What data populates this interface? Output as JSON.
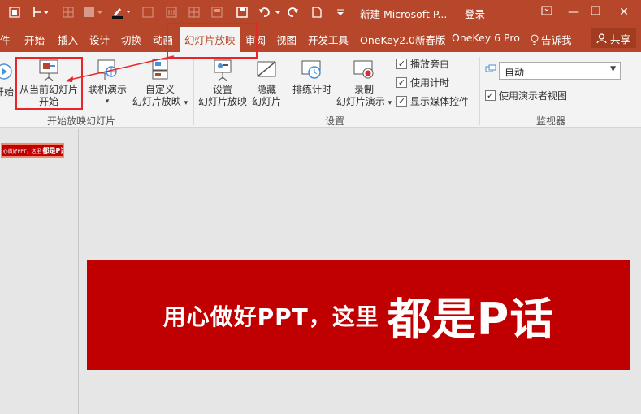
{
  "titlebar": {
    "doc_title": "新建 Microsoft P...",
    "login": "登录",
    "quick_access_icons": [
      "touch-mode-icon",
      "arrow-icon",
      "table-icon",
      "shape-icon",
      "pen-color-icon",
      "grid-icon",
      "bars-icon",
      "save-icon",
      "undo-icon",
      "redo-icon",
      "new-file-icon",
      "customize-icon"
    ]
  },
  "tabs": [
    "件",
    "开始",
    "插入",
    "设计",
    "切换",
    "动画",
    "幻灯片放映",
    "审阅",
    "视图",
    "开发工具",
    "OneKey2.0新春版",
    "OneKey 6 Pro",
    "告诉我"
  ],
  "share": "共享",
  "ribbon": {
    "start_group": {
      "from_start_partial": "开始",
      "from_current_line1": "从当前幻灯片",
      "from_current_line2": "开始",
      "online_present": "联机演示",
      "custom_line1": "自定义",
      "custom_line2": "幻灯片放映",
      "label": "开始放映幻灯片"
    },
    "setup_group": {
      "setup_line1": "设置",
      "setup_line2": "幻灯片放映",
      "hide_line1": "隐藏",
      "hide_line2": "幻灯片",
      "rehearse": "排练计时",
      "record_line1": "录制",
      "record_line2": "幻灯片演示",
      "play_narration": "播放旁白",
      "use_timings": "使用计时",
      "show_media_controls": "显示媒体控件",
      "label": "设置"
    },
    "monitor_group": {
      "monitor_value": "自动",
      "presenter_view": "使用演示者视图",
      "label": "监视器"
    }
  },
  "thumbnail": {
    "text_small": "用心做好PPT，这里",
    "text_big": "都是P话"
  },
  "slide": {
    "text_small": "用心做好PPT，这里",
    "text_big": "都是P话"
  },
  "colors": {
    "accent": "#b7472a",
    "slide_bg": "#c00000",
    "highlight": "#e8262a"
  }
}
